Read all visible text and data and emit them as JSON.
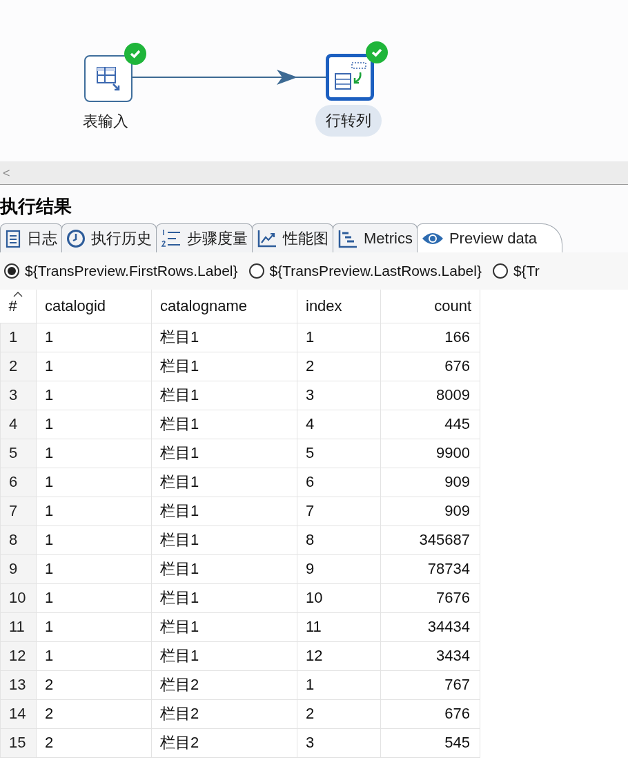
{
  "canvas": {
    "nodes": [
      {
        "label": "表输入",
        "kind": "table-input",
        "selected": false,
        "success": true
      },
      {
        "label": "行转列",
        "kind": "row-to-column",
        "selected": true,
        "success": true
      }
    ]
  },
  "scroll_bar": {
    "arrow": "<"
  },
  "results": {
    "title": "执行结果",
    "tabs": [
      {
        "label": "日志",
        "kind": "log",
        "selected": false
      },
      {
        "label": "执行历史",
        "kind": "history",
        "selected": false
      },
      {
        "label": "步骤度量",
        "kind": "metrics-list",
        "selected": false
      },
      {
        "label": "性能图",
        "kind": "chart",
        "selected": false
      },
      {
        "label": "Metrics",
        "kind": "gantt",
        "selected": false
      },
      {
        "label": "Preview data",
        "kind": "eye",
        "selected": true
      }
    ],
    "options": [
      {
        "label": "${TransPreview.FirstRows.Label}",
        "selected": true
      },
      {
        "label": "${TransPreview.LastRows.Label}",
        "selected": false
      },
      {
        "label": "${Tr",
        "selected": false
      }
    ],
    "table": {
      "columns": [
        {
          "label": "#",
          "sorted": true
        },
        {
          "label": "catalogid",
          "sorted": false
        },
        {
          "label": "catalogname",
          "sorted": false
        },
        {
          "label": "index",
          "sorted": false
        },
        {
          "label": "count",
          "sorted": false
        }
      ],
      "rows": [
        [
          "1",
          "1",
          "栏目1",
          "1",
          "166"
        ],
        [
          "2",
          "1",
          "栏目1",
          "2",
          "676"
        ],
        [
          "3",
          "1",
          "栏目1",
          "3",
          "8009"
        ],
        [
          "4",
          "1",
          "栏目1",
          "4",
          "445"
        ],
        [
          "5",
          "1",
          "栏目1",
          "5",
          "9900"
        ],
        [
          "6",
          "1",
          "栏目1",
          "6",
          "909"
        ],
        [
          "7",
          "1",
          "栏目1",
          "7",
          "909"
        ],
        [
          "8",
          "1",
          "栏目1",
          "8",
          "345687"
        ],
        [
          "9",
          "1",
          "栏目1",
          "9",
          "78734"
        ],
        [
          "10",
          "1",
          "栏目1",
          "10",
          "7676"
        ],
        [
          "11",
          "1",
          "栏目1",
          "11",
          "34434"
        ],
        [
          "12",
          "1",
          "栏目1",
          "12",
          "3434"
        ],
        [
          "13",
          "2",
          "栏目2",
          "1",
          "767"
        ],
        [
          "14",
          "2",
          "栏目2",
          "2",
          "676"
        ],
        [
          "15",
          "2",
          "栏目2",
          "3",
          "545"
        ]
      ]
    }
  }
}
